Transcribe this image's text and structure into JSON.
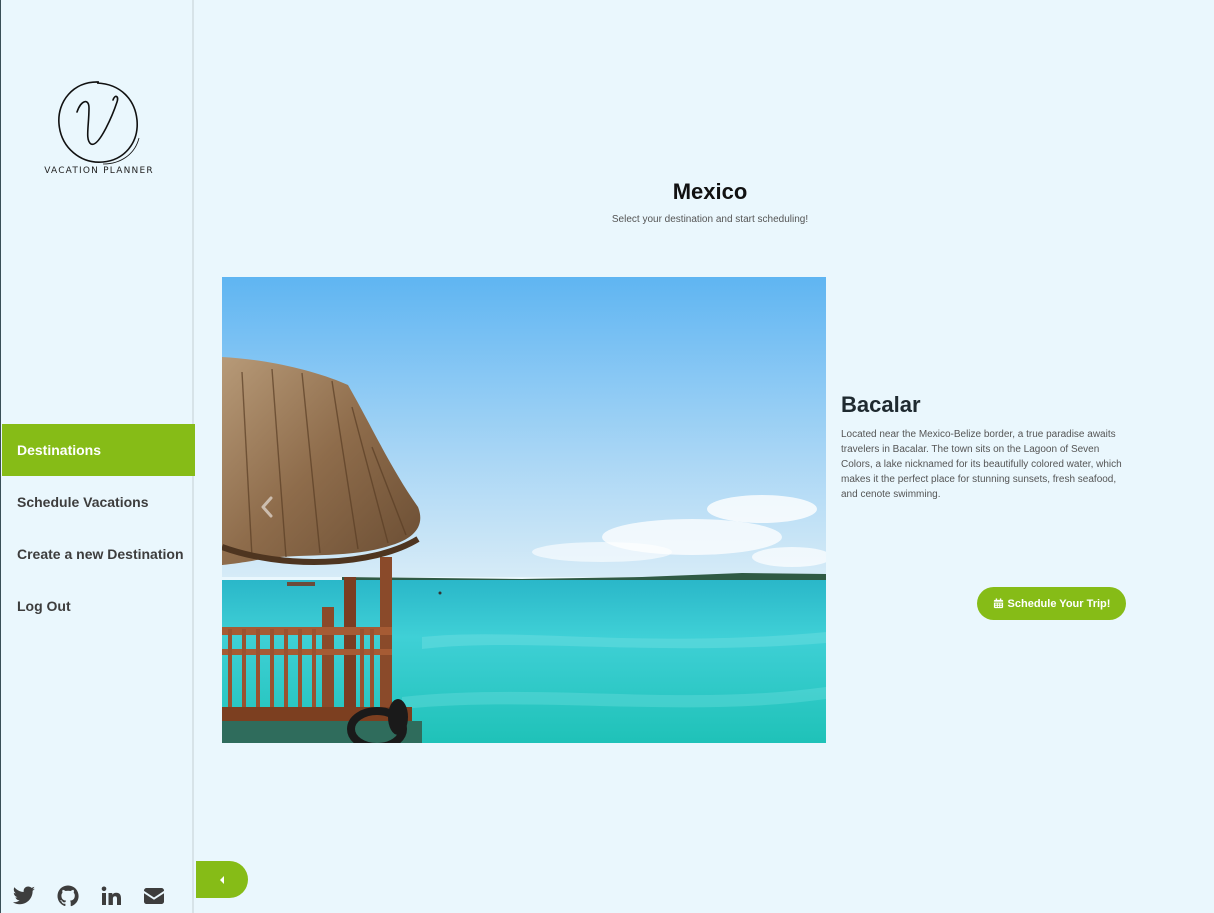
{
  "brand": {
    "logo_letter": "V",
    "logo_text": "VACATION PLANNER"
  },
  "sidebar": {
    "items": [
      {
        "label": "Destinations",
        "active": true
      },
      {
        "label": "Schedule Vacations",
        "active": false
      },
      {
        "label": "Create a new Destination",
        "active": false
      },
      {
        "label": "Log Out",
        "active": false
      }
    ],
    "social_icons": [
      "twitter-icon",
      "github-icon",
      "linkedin-icon",
      "envelope-icon"
    ]
  },
  "main": {
    "title": "Mexico",
    "subtitle": "Select your destination and start scheduling!",
    "destination": {
      "name": "Bacalar",
      "description": "Located near the Mexico-Belize border, a true paradise awaits travelers in Bacalar. The town sits on the Lagoon of Seven Colors, a lake nicknamed for its beautifully colored water, which makes it the perfect place for stunning sunsets, fresh seafood, and cenote swimming."
    },
    "schedule_button": {
      "icon": "calendar-icon",
      "label": "Schedule Your Trip!"
    },
    "carousel_prev_icon": "chevron-left-icon",
    "collapse_icon": "caret-left-icon"
  },
  "colors": {
    "accent": "#86bc17",
    "background": "#eaf7fd",
    "text_dark": "#3d3d3d"
  }
}
